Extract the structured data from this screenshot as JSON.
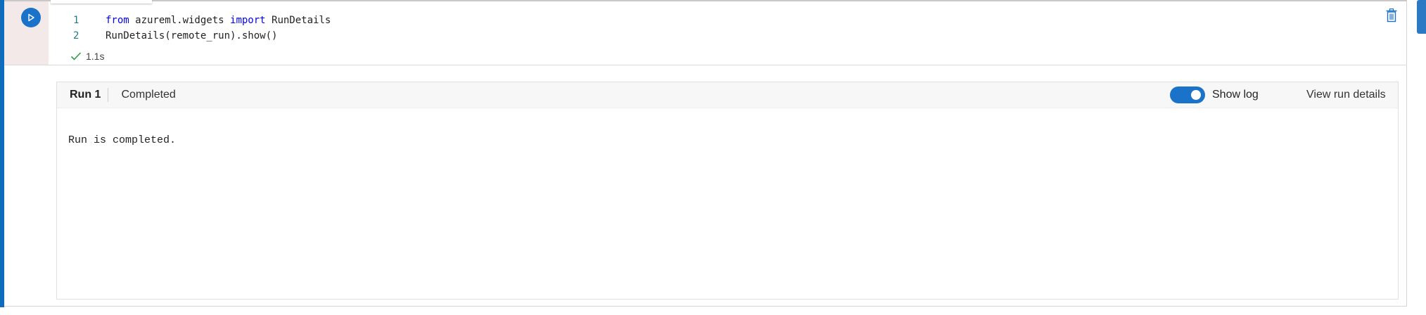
{
  "cell": {
    "code_lines": [
      {
        "number": "1",
        "tokens": [
          {
            "text": "from",
            "kw": true
          },
          {
            "text": " azureml.widgets ",
            "kw": false
          },
          {
            "text": "import",
            "kw": true
          },
          {
            "text": " RunDetails",
            "kw": false
          }
        ]
      },
      {
        "number": "2",
        "tokens": [
          {
            "text": "RunDetails(remote_run).show()",
            "kw": false
          }
        ]
      }
    ],
    "exec_time": "1.1s"
  },
  "widget": {
    "run_title": "Run 1",
    "run_status": "Completed",
    "show_log_label": "Show log",
    "show_log_on": true,
    "view_run_details": "View run details",
    "log_text": "Run is completed."
  },
  "colors": {
    "accent": "#1a73c8",
    "active_bar": "#0f6cbd",
    "keyword": "#0000ff",
    "line_number": "#237893",
    "success": "#2e9e47"
  },
  "icons": {
    "run": "play-circle-icon",
    "delete": "trash-icon",
    "status": "checkmark-icon"
  }
}
